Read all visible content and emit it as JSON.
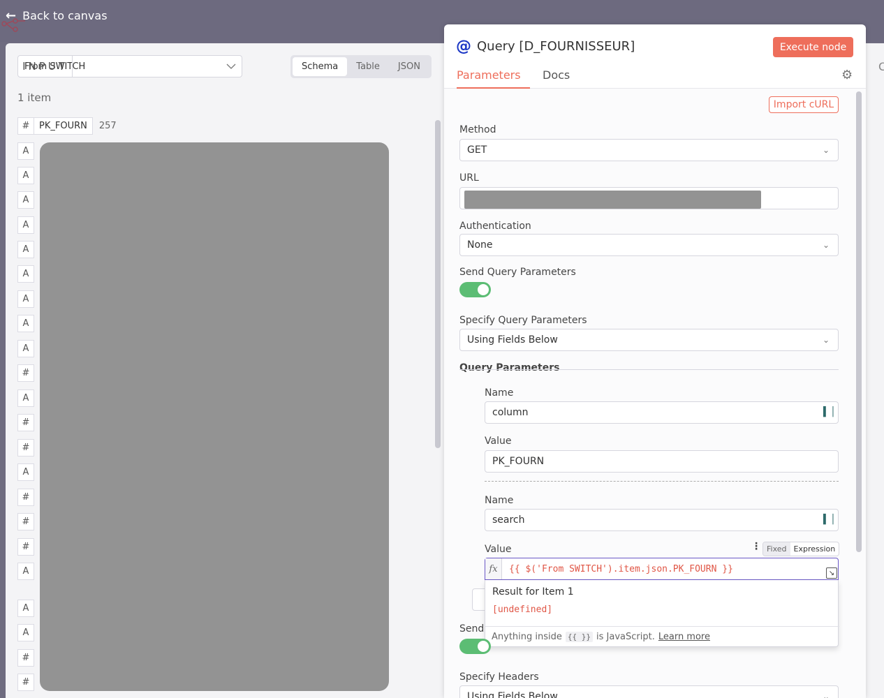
{
  "topbar": {
    "back_label": "Back to canvas"
  },
  "input": {
    "label": "INPUT",
    "source": "From SWITCH",
    "views": [
      "Schema",
      "Table",
      "JSON"
    ],
    "item_count": "1 item",
    "first_field": {
      "type": "#",
      "name": "PK_FOURN",
      "value": "257"
    },
    "field_types": [
      "A",
      "A",
      "A",
      "A",
      "A",
      "A",
      "A",
      "A",
      "A",
      "#",
      "A",
      "#",
      "#",
      "A",
      "#",
      "#",
      "#",
      "A",
      "A",
      "A",
      "#",
      "#"
    ]
  },
  "node": {
    "icon": "@",
    "title": "Query [D_FOURNISSEUR]",
    "execute_label": "Execute node",
    "tabs": [
      "Parameters",
      "Docs"
    ],
    "import_curl": "Import cURL",
    "method": {
      "label": "Method",
      "value": "GET"
    },
    "url": {
      "label": "URL"
    },
    "auth": {
      "label": "Authentication",
      "value": "None"
    },
    "send_query": {
      "label": "Send Query Parameters",
      "on": true
    },
    "specify_query": {
      "label": "Specify Query Parameters",
      "value": "Using Fields Below"
    },
    "query_params_heading": "Query Parameters",
    "params": [
      {
        "name_label": "Name",
        "name": "column",
        "value_label": "Value",
        "value": "PK_FOURN"
      },
      {
        "name_label": "Name",
        "name": "search",
        "value_label": "Value",
        "expression": "{{ $('From SWITCH').item.json.PK_FOURN }}"
      }
    ],
    "mode_toggle": {
      "fixed": "Fixed",
      "expression": "Expression"
    },
    "result": {
      "title": "Result for Item 1",
      "value": "[undefined]",
      "hint_prefix": "Anything inside",
      "hint_braces": "{{ }}",
      "hint_suffix": "is JavaScript.",
      "learn_more": "Learn more"
    },
    "send_headers_partial": "Send",
    "specify_headers": {
      "label": "Specify Headers",
      "value": "Using Fields Below"
    }
  },
  "right_strip_char": "C",
  "colors": {
    "accent": "#ee6e5b",
    "toggle_on": "#5cbd74",
    "expression_border": "#6a58c6",
    "node_icon": "#1c37c5"
  }
}
